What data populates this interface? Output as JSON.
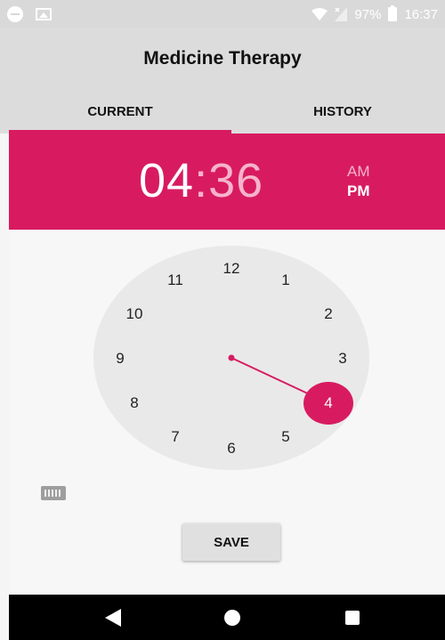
{
  "status_bar": {
    "battery": "97%",
    "time": "16:37",
    "icons": [
      "do-not-disturb-icon",
      "gallery-notification-icon",
      "wifi-icon",
      "signal-icon",
      "battery-icon"
    ]
  },
  "app": {
    "title": "Medicine Therapy"
  },
  "tabs": [
    {
      "label": "CURRENT",
      "selected": true
    },
    {
      "label": "HISTORY",
      "selected": false
    }
  ],
  "time_picker": {
    "hour": "04",
    "separator": ":",
    "minute": "36",
    "am_label": "AM",
    "pm_label": "PM",
    "selected_period": "PM",
    "selected_hour": 4,
    "dial_numbers": [
      "12",
      "1",
      "2",
      "3",
      "4",
      "5",
      "6",
      "7",
      "8",
      "9",
      "10",
      "11"
    ]
  },
  "actions": {
    "save_label": "SAVE"
  },
  "colors": {
    "accent": "#d81b60",
    "accent_light": "#f6b3cb",
    "dial_background": "#e9e9e9",
    "app_bar": "#dcdcdc"
  },
  "nav_bar": {
    "icons": [
      "back-icon",
      "home-icon",
      "recents-icon"
    ]
  }
}
